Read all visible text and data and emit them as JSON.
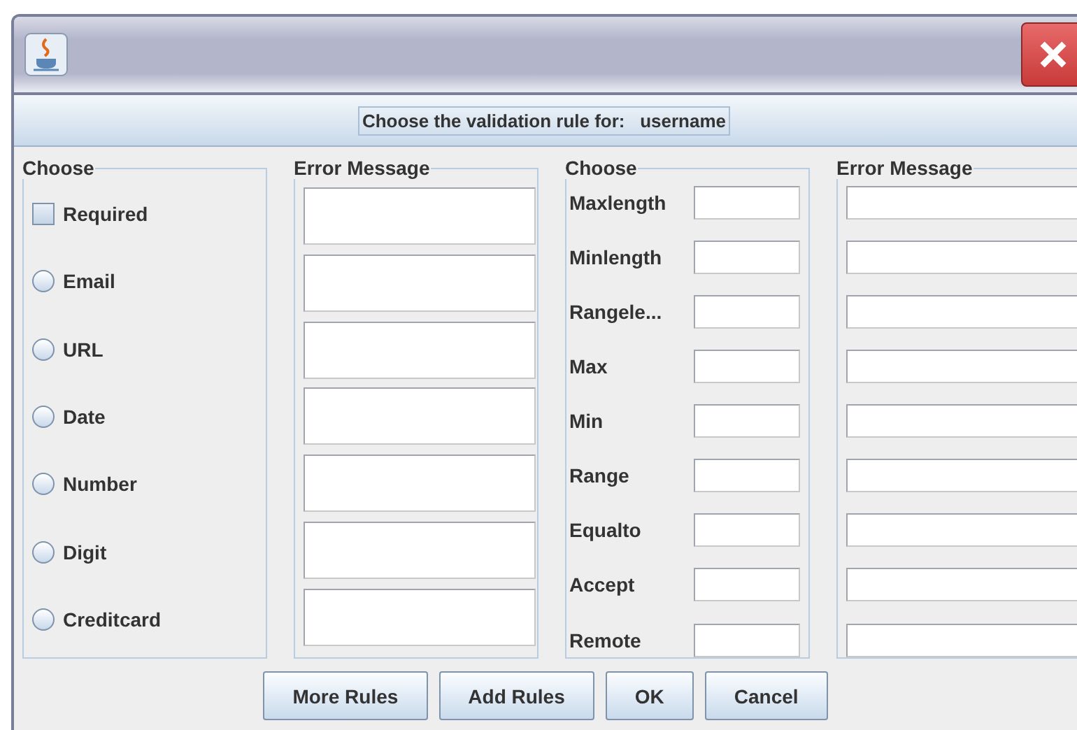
{
  "header": {
    "text": "Choose the validation rule for:   username"
  },
  "left_group": {
    "title": "Choose",
    "rules": [
      {
        "kind": "checkbox",
        "label": "Required",
        "checked": false
      },
      {
        "kind": "radio",
        "label": "Email",
        "checked": false
      },
      {
        "kind": "radio",
        "label": "URL",
        "checked": false
      },
      {
        "kind": "radio",
        "label": "Date",
        "checked": false
      },
      {
        "kind": "radio",
        "label": "Number",
        "checked": false
      },
      {
        "kind": "radio",
        "label": "Digit",
        "checked": false
      },
      {
        "kind": "radio",
        "label": "Creditcard",
        "checked": false
      }
    ]
  },
  "left_messages": {
    "title": "Error Message"
  },
  "right_group": {
    "title": "Choose",
    "rules": [
      {
        "label": "Maxlength"
      },
      {
        "label": "Minlength"
      },
      {
        "label": "Rangele..."
      },
      {
        "label": "Max"
      },
      {
        "label": "Min"
      },
      {
        "label": "Range"
      },
      {
        "label": "Equalto"
      },
      {
        "label": "Accept"
      },
      {
        "label": "Remote"
      }
    ]
  },
  "right_messages": {
    "title": "Error Message"
  },
  "buttons": [
    "More Rules",
    "Add Rules",
    "OK",
    "Cancel"
  ]
}
